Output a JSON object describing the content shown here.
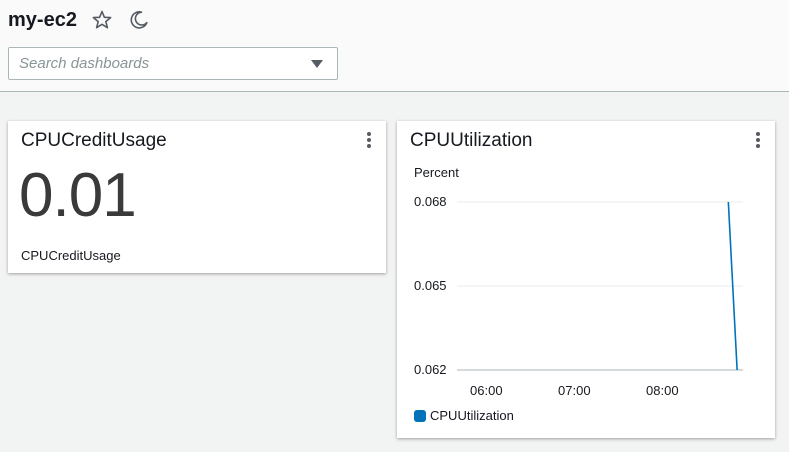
{
  "header": {
    "title": "my-ec2",
    "favorite_icon": "star-outline-icon",
    "theme_icon": "moon-icon",
    "search": {
      "placeholder": "Search dashboards",
      "value": ""
    }
  },
  "widgets": [
    {
      "title": "CPUCreditUsage",
      "value": "0.01",
      "metric_label": "CPUCreditUsage",
      "menu_icon": "kebab-menu-icon"
    },
    {
      "title": "CPUUtilization",
      "menu_icon": "kebab-menu-icon"
    }
  ],
  "chart_data": {
    "type": "line",
    "ylabel": "Percent",
    "xlabel": "",
    "ylim": [
      0.062,
      0.068
    ],
    "yticks": [
      "0.068",
      "0.065",
      "0.062"
    ],
    "xticks": [
      "06:00",
      "07:00",
      "08:00"
    ],
    "x_range": [
      "05:40",
      "08:55"
    ],
    "grid": true,
    "legend_position": "bottom-left",
    "series": [
      {
        "name": "CPUUtilization",
        "color": "#0073bb",
        "points": [
          {
            "x": "08:45",
            "y": 0.068
          },
          {
            "x": "08:51",
            "y": 0.062
          }
        ]
      }
    ]
  }
}
